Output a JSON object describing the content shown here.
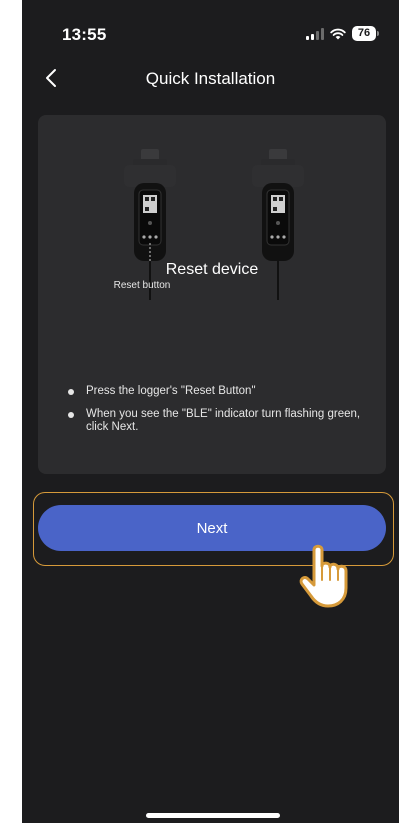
{
  "status_bar": {
    "time": "13:55",
    "battery_level": "76",
    "signal_bars_active": 2,
    "signal_bars_total": 4,
    "wifi_icon": "wifi-icon"
  },
  "nav": {
    "back_icon": "chevron-left-icon",
    "title": "Quick Installation"
  },
  "card": {
    "illustration_label": "Reset button",
    "title": "Reset device",
    "bullets": [
      "Press the logger's \"Reset Button\"",
      "When you see the \"BLE\" indicator turn flashing green, click Next."
    ]
  },
  "actions": {
    "next_label": "Next"
  },
  "colors": {
    "background": "#1c1c1e",
    "card": "#2c2c2e",
    "primary": "#4a64c8",
    "highlight": "#d69a3a"
  }
}
